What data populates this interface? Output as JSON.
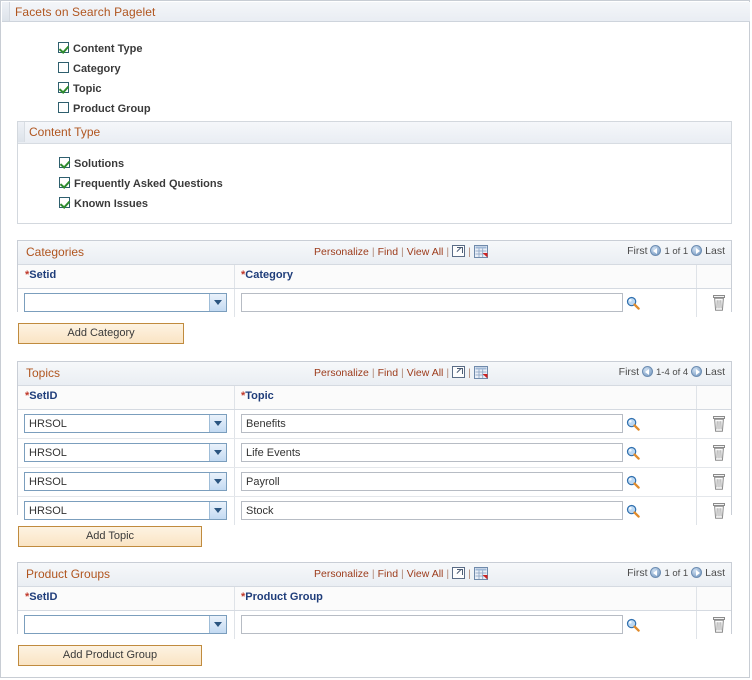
{
  "pagelet": {
    "title": "Facets on Search Pagelet"
  },
  "facets": {
    "items": [
      {
        "label": "Content Type",
        "checked": true
      },
      {
        "label": "Category",
        "checked": false
      },
      {
        "label": "Topic",
        "checked": true
      },
      {
        "label": "Product Group",
        "checked": false
      }
    ]
  },
  "content_type_group": {
    "title": "Content Type",
    "items": [
      {
        "label": "Solutions",
        "checked": true
      },
      {
        "label": "Frequently Asked Questions",
        "checked": true
      },
      {
        "label": "Known Issues",
        "checked": true
      }
    ]
  },
  "grid_links": {
    "personalize": "Personalize",
    "find": "Find",
    "view_all": "View All",
    "separator": "|",
    "expand_icon": "expand-new-window-icon",
    "spreadsheet_icon": "download-to-spreadsheet-icon"
  },
  "grid_nav": {
    "first": "First",
    "last": "Last",
    "prev_icon": "previous-page-arrow-icon",
    "next_icon": "next-page-arrow-icon"
  },
  "categories": {
    "title": "Categories",
    "counter": "1 of 1",
    "columns": {
      "setid": "Setid",
      "value": "Category",
      "required_marker": "*"
    },
    "rows": [
      {
        "setid": "",
        "value": ""
      }
    ],
    "add_button": "Add Category"
  },
  "topics": {
    "title": "Topics",
    "counter": "1-4 of 4",
    "columns": {
      "setid": "SetID",
      "value": "Topic",
      "required_marker": "*"
    },
    "rows": [
      {
        "setid": "HRSOL",
        "value": "Benefits"
      },
      {
        "setid": "HRSOL",
        "value": "Life Events"
      },
      {
        "setid": "HRSOL",
        "value": "Payroll"
      },
      {
        "setid": "HRSOL",
        "value": "Stock"
      }
    ],
    "add_button": "Add Topic"
  },
  "product_groups": {
    "title": "Product Groups",
    "counter": "1 of 1",
    "columns": {
      "setid": "SetID",
      "value": "Product Group",
      "required_marker": "*"
    },
    "rows": [
      {
        "setid": "",
        "value": ""
      }
    ],
    "add_button": "Add Product Group"
  },
  "icons": {
    "lookup": "lookup-magnifier-icon",
    "delete": "delete-row-trash-icon",
    "checkbox_checked": "checkbox-checked-icon",
    "checkbox_unchecked": "checkbox-unchecked-icon"
  },
  "colors": {
    "title_text": "#b0551f",
    "column_header_text": "#1f3d7a",
    "required_marker": "#c0392b",
    "link": "#9c3b1b",
    "button_border": "#c08b3e",
    "checkbox_check": "#2e8b2e"
  }
}
